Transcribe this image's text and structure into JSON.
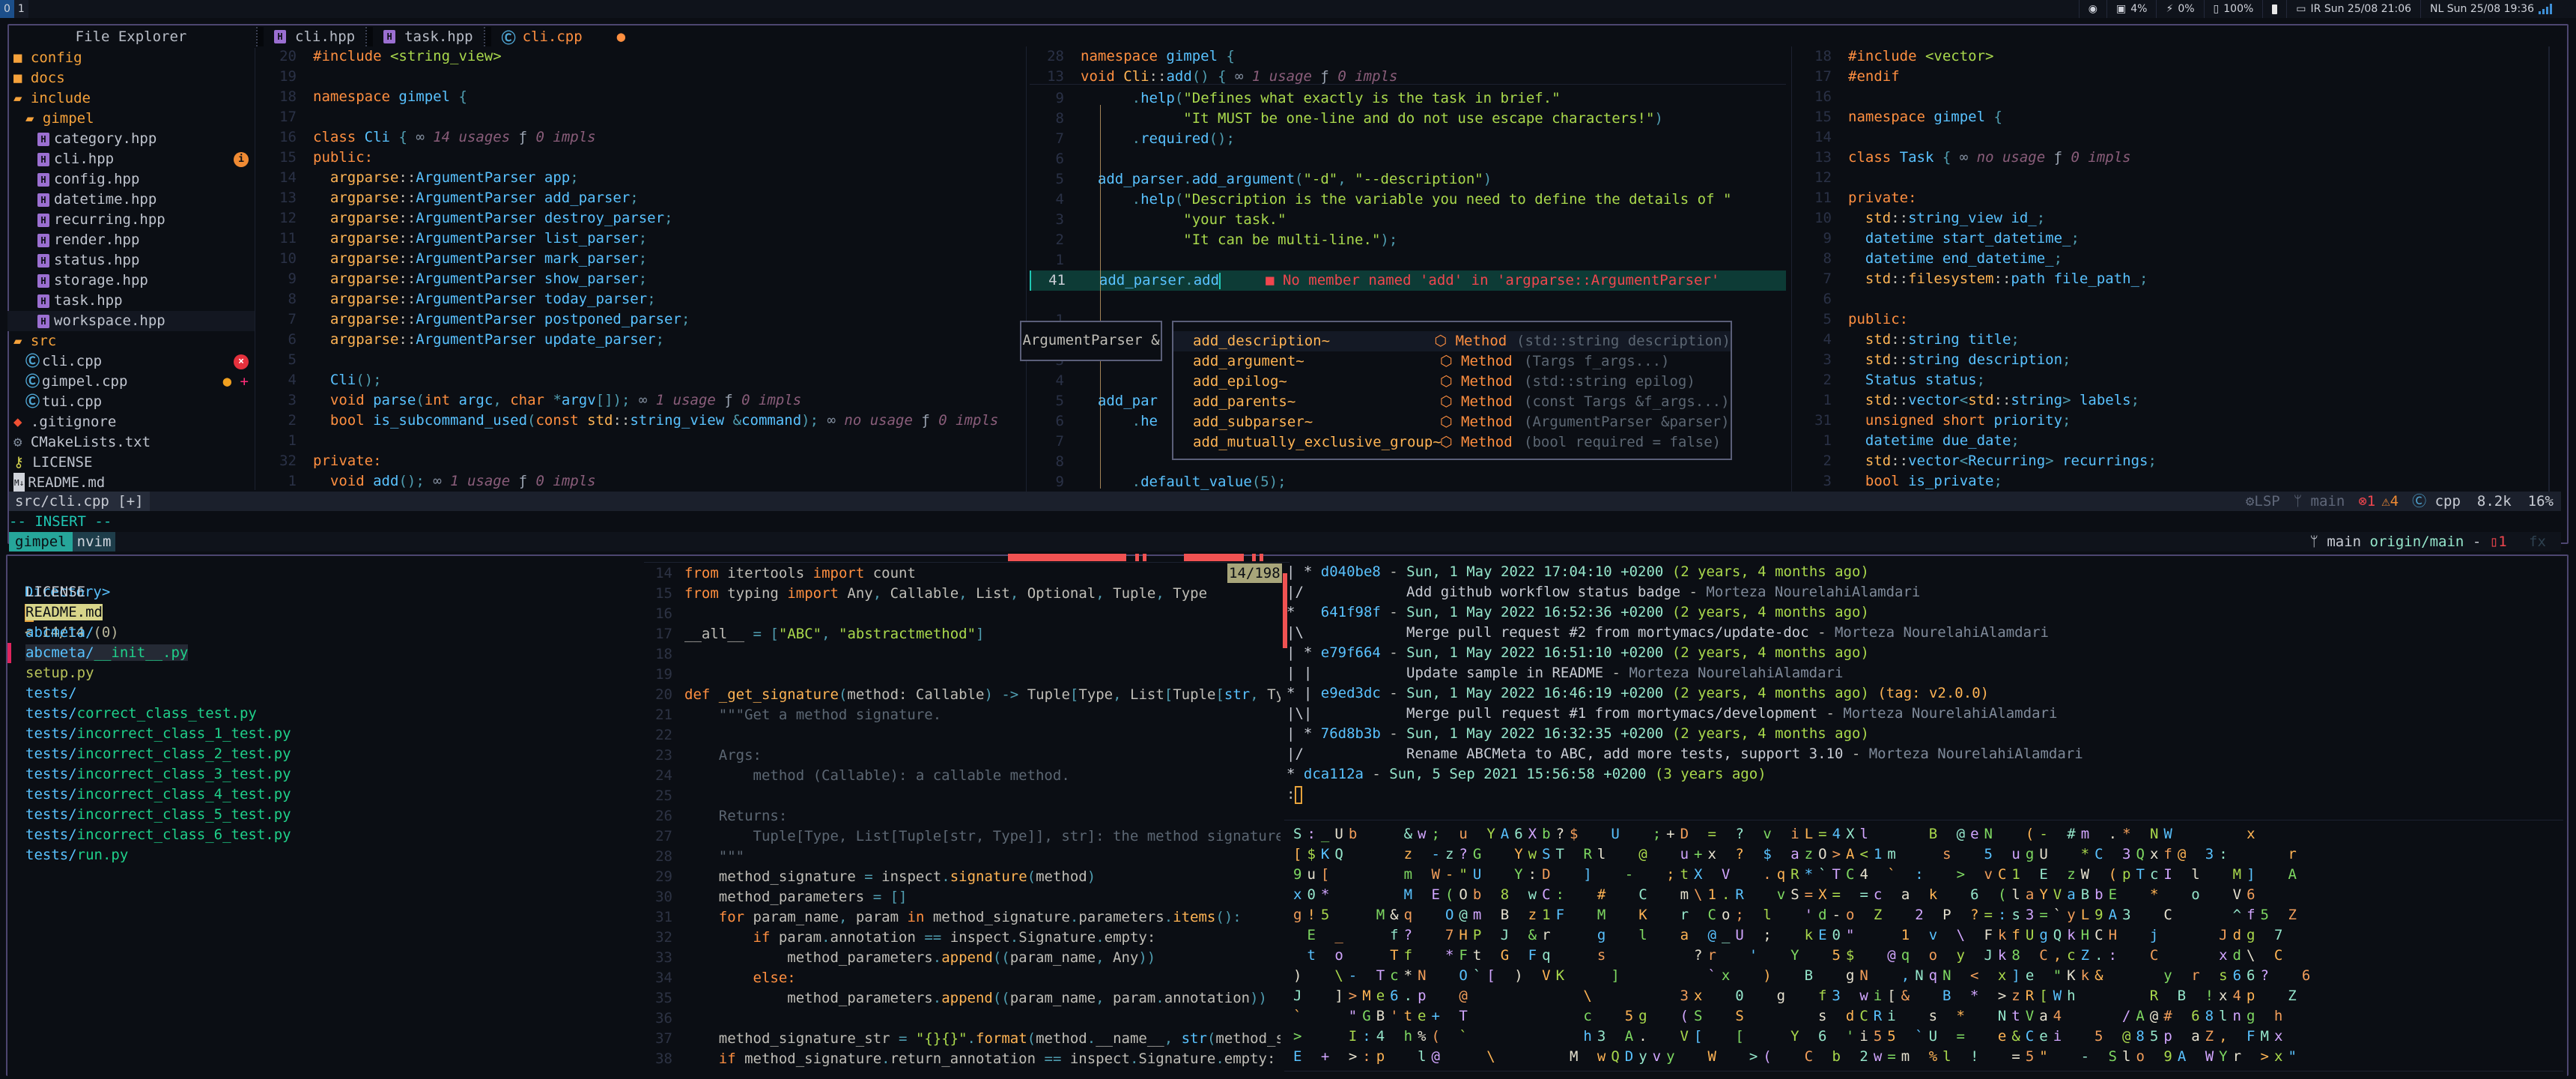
{
  "topbar": {
    "workspaces": [
      {
        "label": "0",
        "active": true
      },
      {
        "label": "1",
        "active": false
      }
    ],
    "system": {
      "cpu": "4%",
      "gpu": "0%",
      "volume": "100%",
      "clock_ir": "IR Sun 25/08 21:06",
      "clock_nl": "NL Sun 25/08 19:36"
    }
  },
  "explorer": {
    "title": "File Explorer",
    "items": [
      {
        "label": "config",
        "type": "folder",
        "depth": 0
      },
      {
        "label": "docs",
        "type": "folder",
        "depth": 0
      },
      {
        "label": "include",
        "type": "folder-open",
        "depth": 0
      },
      {
        "label": "gimpel",
        "type": "folder-open",
        "depth": 1
      },
      {
        "label": "category.hpp",
        "type": "hpp",
        "depth": 2
      },
      {
        "label": "cli.hpp",
        "type": "hpp",
        "depth": 2,
        "badge": "info"
      },
      {
        "label": "config.hpp",
        "type": "hpp",
        "depth": 2
      },
      {
        "label": "datetime.hpp",
        "type": "hpp",
        "depth": 2
      },
      {
        "label": "recurring.hpp",
        "type": "hpp",
        "depth": 2
      },
      {
        "label": "render.hpp",
        "type": "hpp",
        "depth": 2
      },
      {
        "label": "status.hpp",
        "type": "hpp",
        "depth": 2
      },
      {
        "label": "storage.hpp",
        "type": "hpp",
        "depth": 2
      },
      {
        "label": "task.hpp",
        "type": "hpp",
        "depth": 2
      },
      {
        "label": "workspace.hpp",
        "type": "hpp",
        "depth": 2,
        "selected": true
      },
      {
        "label": "src",
        "type": "folder-open",
        "depth": 0
      },
      {
        "label": "cli.cpp",
        "type": "cpp",
        "depth": 1,
        "badge": "error"
      },
      {
        "label": "gimpel.cpp",
        "type": "cpp",
        "depth": 1,
        "badge": "modified-added"
      },
      {
        "label": "tui.cpp",
        "type": "cpp",
        "depth": 1
      },
      {
        "label": ".gitignore",
        "type": "git",
        "depth": 0
      },
      {
        "label": "CMakeLists.txt",
        "type": "cmake",
        "depth": 0
      },
      {
        "label": "LICENSE",
        "type": "license",
        "depth": 0
      },
      {
        "label": "README.md",
        "type": "markdown",
        "depth": 0
      }
    ]
  },
  "tabs": [
    {
      "label": "cli.hpp",
      "type": "hpp",
      "active": false
    },
    {
      "label": "task.hpp",
      "type": "hpp",
      "active": false
    },
    {
      "label": "cli.cpp",
      "type": "cpp",
      "active": true,
      "modified": true
    }
  ],
  "editor_left": {
    "lines": [
      {
        "n": "20",
        "code": "#include <string_view>"
      },
      {
        "n": "19",
        "code": ""
      },
      {
        "n": "18",
        "code": "namespace gimpel {"
      },
      {
        "n": "17",
        "code": ""
      },
      {
        "n": "16",
        "code": "class Cli {",
        "hint": "14 usages  0 impls"
      },
      {
        "n": "15",
        "code": "public:"
      },
      {
        "n": "14",
        "code": "  argparse::ArgumentParser app;"
      },
      {
        "n": "13",
        "code": "  argparse::ArgumentParser add_parser;"
      },
      {
        "n": "12",
        "code": "  argparse::ArgumentParser destroy_parser;"
      },
      {
        "n": "11",
        "code": "  argparse::ArgumentParser list_parser;"
      },
      {
        "n": "10",
        "code": "  argparse::ArgumentParser mark_parser;"
      },
      {
        "n": "9",
        "code": "  argparse::ArgumentParser show_parser;"
      },
      {
        "n": "8",
        "code": "  argparse::ArgumentParser today_parser;"
      },
      {
        "n": "7",
        "code": "  argparse::ArgumentParser postponed_parser;"
      },
      {
        "n": "6",
        "code": "  argparse::ArgumentParser update_parser;"
      },
      {
        "n": "5",
        "code": ""
      },
      {
        "n": "4",
        "code": "  Cli();"
      },
      {
        "n": "3",
        "code": "  void parse(int argc, char *argv[]);",
        "hint": "1 usage  0 impls"
      },
      {
        "n": "2",
        "code": "  bool is_subcommand_used(const std::string_view &command);",
        "hint": "no usage  0 impls"
      },
      {
        "n": "1",
        "code": ""
      },
      {
        "n": "32",
        "code": "private:"
      },
      {
        "n": "1",
        "code": "  void add();",
        "hint": "1 usage  0 impls"
      }
    ]
  },
  "editor_mid": {
    "context": [
      {
        "n": "28",
        "code": "namespace gimpel {"
      },
      {
        "n": "13",
        "code": "void Cli::add() {",
        "hint": "1 usage  0 impls"
      }
    ],
    "lines": [
      {
        "n": "9",
        "code": "      .help(\"Defines what exactly is the task in brief.\""
      },
      {
        "n": "8",
        "code": "            \"It MUST be one-line and do not use escape characters!\")"
      },
      {
        "n": "7",
        "code": "      .required();"
      },
      {
        "n": "6",
        "code": ""
      },
      {
        "n": "5",
        "code": "  add_parser.add_argument(\"-d\", \"--description\")"
      },
      {
        "n": "4",
        "code": "      .help(\"Description is the variable you need to define the details of \""
      },
      {
        "n": "3",
        "code": "            \"your task.\""
      },
      {
        "n": "2",
        "code": "            \"It can be multi-line.\");"
      },
      {
        "n": "1",
        "code": ""
      },
      {
        "n": "41",
        "code": "  add_parser.add",
        "current": true,
        "diagnostic": "No member named 'add' in 'argparse::ArgumentParser'"
      }
    ],
    "after_lines": [
      {
        "n": "1",
        "code": ""
      },
      {
        "n": "2",
        "code": ""
      },
      {
        "n": "3",
        "code": ""
      },
      {
        "n": "4",
        "code": ""
      },
      {
        "n": "5",
        "code": "  add_par"
      },
      {
        "n": "6",
        "code": "      .he"
      },
      {
        "n": "7",
        "code": ""
      },
      {
        "n": "8",
        "code": ""
      },
      {
        "n": "9",
        "code": "      .default_value(5);"
      }
    ],
    "signature_hint": "ArgumentParser &",
    "completion": [
      {
        "name": "add_description~",
        "kind": "Method",
        "detail": "(std::string description)",
        "selected": true
      },
      {
        "name": "add_argument~",
        "kind": "Method",
        "detail": "(Targs f_args...)"
      },
      {
        "name": "add_epilog~",
        "kind": "Method",
        "detail": "(std::string epilog)"
      },
      {
        "name": "add_parents~",
        "kind": "Method",
        "detail": "(const Targs &f_args...)"
      },
      {
        "name": "add_subparser~",
        "kind": "Method",
        "detail": "(ArgumentParser &parser)"
      },
      {
        "name": "add_mutually_exclusive_group~",
        "kind": "Method",
        "detail": "(bool required = false)"
      }
    ]
  },
  "editor_right": {
    "lines": [
      {
        "n": "18",
        "code": "#include <vector>"
      },
      {
        "n": "17",
        "code": "#endif"
      },
      {
        "n": "16",
        "code": ""
      },
      {
        "n": "15",
        "code": "namespace gimpel {"
      },
      {
        "n": "14",
        "code": ""
      },
      {
        "n": "13",
        "code": "class Task {",
        "hint": "no usage  0 impls"
      },
      {
        "n": "12",
        "code": ""
      },
      {
        "n": "11",
        "code": "private:"
      },
      {
        "n": "10",
        "code": "  std::string_view id_;"
      },
      {
        "n": "9",
        "code": "  datetime start_datetime_;"
      },
      {
        "n": "8",
        "code": "  datetime end_datetime_;"
      },
      {
        "n": "7",
        "code": "  std::filesystem::path file_path_;"
      },
      {
        "n": "6",
        "code": ""
      },
      {
        "n": "5",
        "code": "public:"
      },
      {
        "n": "4",
        "code": "  std::string title;"
      },
      {
        "n": "3",
        "code": "  std::string description;"
      },
      {
        "n": "2",
        "code": "  Status status;"
      },
      {
        "n": "1",
        "code": "  std::vector<std::string> labels;"
      },
      {
        "n": "31",
        "code": "  unsigned short priority;"
      },
      {
        "n": "1",
        "code": "  datetime due_date;"
      },
      {
        "n": "2",
        "code": "  std::vector<Recurring> recurrings;"
      },
      {
        "n": "3",
        "code": "  bool is_private;"
      }
    ]
  },
  "statusline": {
    "file": "src/cli.cpp [+]",
    "lsp": "LSP",
    "branch": "main",
    "errors": "1",
    "warnings": "4",
    "filetype": "cpp",
    "size": "8.2k",
    "percent": "16%"
  },
  "mode": "-- INSERT --",
  "tmux": {
    "session": "gimpel",
    "window": "nvim",
    "branch": "main",
    "remote": "origin/main",
    "separator": "-",
    "changed": "1",
    "fx": "fx"
  },
  "fzf": {
    "prompt": "Directory>",
    "counter": "< 14/14 (0)",
    "items": [
      {
        "dir": "",
        "name": "LICENSE",
        "style": "plain"
      },
      {
        "dir": "",
        "name": "README.md",
        "style": "highlight"
      },
      {
        "dir": "abcmeta/",
        "name": "",
        "style": "dir"
      },
      {
        "dir": "abcmeta/",
        "name": "__init__.py",
        "style": "current"
      },
      {
        "dir": "",
        "name": "setup.py",
        "style": "py"
      },
      {
        "dir": "tests/",
        "name": "",
        "style": "dir"
      },
      {
        "dir": "tests/",
        "name": "correct_class_test.py",
        "style": "match"
      },
      {
        "dir": "tests/",
        "name": "incorrect_class_1_test.py",
        "style": "match"
      },
      {
        "dir": "tests/",
        "name": "incorrect_class_2_test.py",
        "style": "match"
      },
      {
        "dir": "tests/",
        "name": "incorrect_class_3_test.py",
        "style": "match"
      },
      {
        "dir": "tests/",
        "name": "incorrect_class_4_test.py",
        "style": "match"
      },
      {
        "dir": "tests/",
        "name": "incorrect_class_5_test.py",
        "style": "match"
      },
      {
        "dir": "tests/",
        "name": "incorrect_class_6_test.py",
        "style": "match"
      },
      {
        "dir": "tests/",
        "name": "run.py",
        "style": "match"
      }
    ]
  },
  "preview": {
    "position": "14/198",
    "lines": [
      {
        "n": "14",
        "code": "from itertools import count"
      },
      {
        "n": "15",
        "code": "from typing import Any, Callable, List, Optional, Tuple, Type"
      },
      {
        "n": "16",
        "code": ""
      },
      {
        "n": "17",
        "code": "__all__ = [\"ABC\", \"abstractmethod\"]"
      },
      {
        "n": "18",
        "code": ""
      },
      {
        "n": "19",
        "code": ""
      },
      {
        "n": "20",
        "code": "def _get_signature(method: Callable) -> Tuple[Type, List[Tuple[str, Type"
      },
      {
        "n": "21",
        "code": "    \"\"\"Get a method signature."
      },
      {
        "n": "22",
        "code": ""
      },
      {
        "n": "23",
        "code": "    Args:"
      },
      {
        "n": "24",
        "code": "        method (Callable): a callable method."
      },
      {
        "n": "25",
        "code": ""
      },
      {
        "n": "26",
        "code": "    Returns:"
      },
      {
        "n": "27",
        "code": "        Tuple[Type, List[Tuple[str, Type]], str]: the method signature."
      },
      {
        "n": "28",
        "code": "    \"\"\""
      },
      {
        "n": "29",
        "code": "    method_signature = inspect.signature(method)"
      },
      {
        "n": "30",
        "code": "    method_parameters = []"
      },
      {
        "n": "31",
        "code": "    for param_name, param in method_signature.parameters.items():"
      },
      {
        "n": "32",
        "code": "        if param.annotation == inspect.Signature.empty:"
      },
      {
        "n": "33",
        "code": "            method_parameters.append((param_name, Any))"
      },
      {
        "n": "34",
        "code": "        else:"
      },
      {
        "n": "35",
        "code": "            method_parameters.append((param_name, param.annotation))"
      },
      {
        "n": "36",
        "code": ""
      },
      {
        "n": "37",
        "code": "    method_signature_str = \"{}{}\".format(method.__name__, str(method_sig"
      },
      {
        "n": "38",
        "code": "    if method_signature.return_annotation == inspect.Signature.empty:"
      }
    ]
  },
  "gitlog": {
    "entries": [
      {
        "graph": "| *",
        "hash": "d040be8",
        "date": "Sun, 1 May 2022 17:04:10 +0200",
        "rel": "(2 years, 4 months ago)",
        "tag": "",
        "msg_graph": "|/",
        "msg": "Add github workflow status badge",
        "author": "Morteza NourelahiAlamdari"
      },
      {
        "graph": "*  ",
        "hash": "641f98f",
        "date": "Sun, 1 May 2022 16:52:36 +0200",
        "rel": "(2 years, 4 months ago)",
        "tag": "",
        "msg_graph": "|\\",
        "msg": "Merge pull request #2 from mortymacs/update-doc",
        "author": "Morteza NourelahiAlamdari"
      },
      {
        "graph": "| *",
        "hash": "e79f664",
        "date": "Sun, 1 May 2022 16:51:10 +0200",
        "rel": "(2 years, 4 months ago)",
        "tag": "",
        "msg_graph": "| |",
        "msg": "Update sample in README",
        "author": "Morteza NourelahiAlamdari"
      },
      {
        "graph": "* |",
        "hash": "e9ed3dc",
        "date": "Sun, 1 May 2022 16:46:19 +0200",
        "rel": "(2 years, 4 months ago)",
        "tag": "(tag: v2.0.0)",
        "msg_graph": "|\\|",
        "msg": "Merge pull request #1 from mortymacs/development",
        "author": "Morteza NourelahiAlamdari"
      },
      {
        "graph": "| *",
        "hash": "76d8b3b",
        "date": "Sun, 1 May 2022 16:32:35 +0200",
        "rel": "(2 years, 4 months ago)",
        "tag": "",
        "msg_graph": "|/",
        "msg": "Rename ABCMeta to ABC, add more tests, support 3.10",
        "author": "Morteza NourelahiAlamdari"
      },
      {
        "graph": "*",
        "hash": "dca112a",
        "date": "Sun, 5 Sep 2021 15:56:58 +0200",
        "rel": "(3 years ago)",
        "tag": "",
        "msg_graph": "",
        "msg": "",
        "author": ""
      }
    ],
    "pager_prompt": ":"
  },
  "matrix": {
    "rows": [
      "S:_Ub   &w; u YA6Xb?$  U  ;+D = ? v iL=4Xl    B @eN  (- #m .* NW     x",
      "[$KQ    z -z?G  YwST Rl  @  u+x ? $ azO>A<1m   s  5 ugU  *C 3Qxf@ 3:    r",
      "9u[     m W-\"U  Y:D  ]  -  ;tX V  .qR*`TC4 ` :  > vC1 E zW (pTcI l  M]  A",
      "x0*     M E(Ob 8 wC:  #  C  m\\1.R  vS=X= =c a k  6 (laYVaBbE  *  o  V6",
      "g!5   M&q  O@m B z1F  M  K  r Co; l  'd-o Z  2 P ?=:s3=`yL9A3  C    ^f5 Z",
      " E _   f?  7HP J &r   g  l  a @_U ;  kE0\"   1 v \\ FkfUgQkHCH  j    Jdg 7",
      " t o   Tf  *Ft G Fq   s      ?r  '  Y  5$  @q o y Jk8 C,cZ.:  C    xd\\ C",
      ")  \\- Tc*N  O`[ ) VK   ]      `x  )  B  gN  ,NqN < x]e \"Kk&    y r s66?  6",
      "J  ]>Me6.p  @        \\      3x  0  g  f3 wi[&  B * >zR[Wh     R B !x4p  Z",
      "`   \"GB'te+ T        c  5g  (S  S     s dCRi  s *  NtVa4    /A@# 68lng h",
      ">   I:4 h%( `        h3 A.  V[  [   Y 6 'i55 `U =  e&Cei  5 @85p aZ, FMx",
      "E + >:p  l@   \\     M wQDyvy  W  >(  C b 2w=m %l !  =5\"  - Slo 9A WYr >x\""
    ]
  }
}
